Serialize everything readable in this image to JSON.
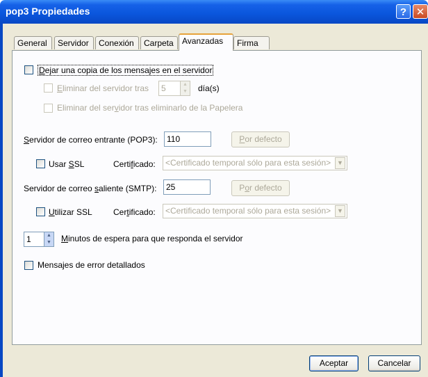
{
  "window": {
    "title": "pop3 Propiedades",
    "help_glyph": "?",
    "close_glyph": "✕"
  },
  "tabs": [
    {
      "label": "General"
    },
    {
      "label": "Servidor"
    },
    {
      "label": "Conexión"
    },
    {
      "label": "Carpeta"
    },
    {
      "label": "Avanzadas",
      "active": true
    },
    {
      "label": "Firma"
    }
  ],
  "leave_copy": {
    "label_u": "D",
    "label_rest": "ejar una copia de los mensajes en el servidor",
    "checked": false
  },
  "remove_after": {
    "label_u": "E",
    "label_rest": "liminar del servidor tras",
    "value": "5",
    "unit": "día(s)",
    "enabled": false
  },
  "remove_deleted": {
    "label_pre": "Eliminar del ser",
    "label_u": "v",
    "label_rest": "idor tras eliminarlo de la Papelera",
    "enabled": false
  },
  "incoming": {
    "label_u": "S",
    "label_rest": "ervidor de correo entrante (POP3):",
    "port": "110",
    "default_u": "P",
    "default_rest": "or defecto",
    "ssl_pre": "Usar ",
    "ssl_u": "S",
    "ssl_rest": "SL",
    "cert_pre": "Certi",
    "cert_u": "f",
    "cert_rest": "icado:",
    "cert_value": "<Certificado temporal sólo para esta sesión>"
  },
  "outgoing": {
    "label_pre": "Servidor de correo ",
    "label_u": "s",
    "label_rest": "aliente (SMTP):",
    "port": "25",
    "default_pre": "P",
    "default_u": "o",
    "default_rest": "r defecto",
    "ssl_u": "U",
    "ssl_rest": "tilizar SSL",
    "cert_pre": "Cer",
    "cert_u": "t",
    "cert_rest": "ificado:",
    "cert_value": "<Certificado temporal sólo para esta sesión>"
  },
  "timeout": {
    "value": "1",
    "label_u": "M",
    "label_rest": "inutos de espera para que responda el servidor"
  },
  "detailed_errors": {
    "label": "Mensajes de error detallados",
    "checked": false
  },
  "footer": {
    "ok": "Aceptar",
    "cancel": "Cancelar"
  },
  "colors": {
    "titlebar": "#0a55dc",
    "dialog_bg": "#ece9d8",
    "panel_bg": "#fcfcfe",
    "disabled_text": "#aca899",
    "tab_highlight": "#e7a23a"
  }
}
